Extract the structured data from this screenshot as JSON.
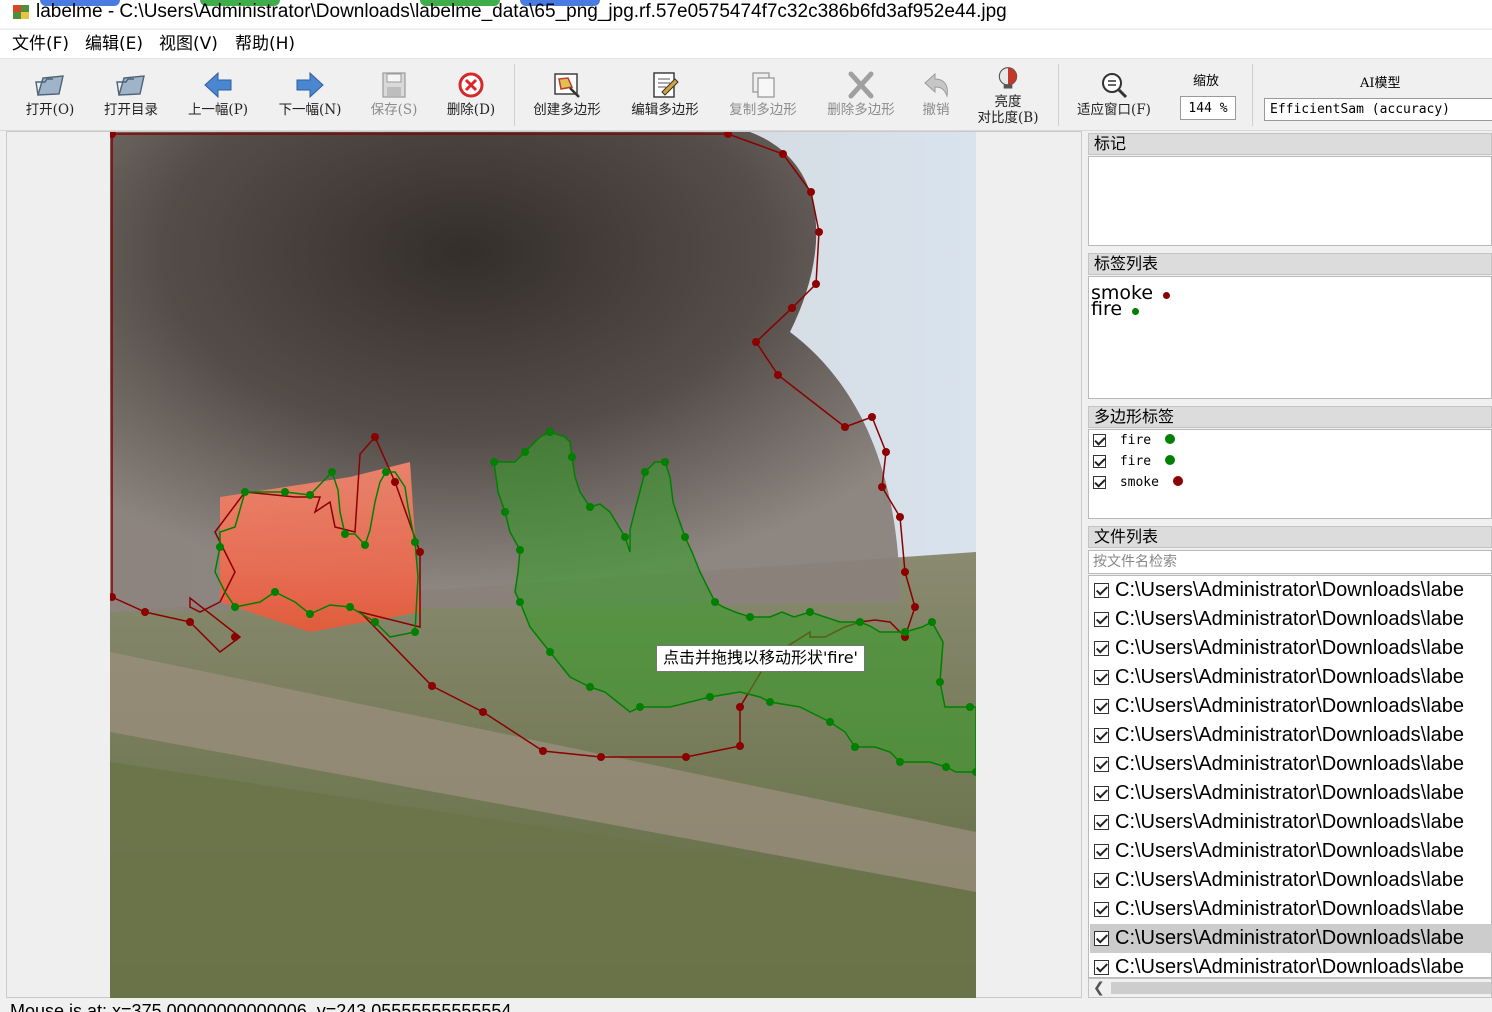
{
  "window": {
    "title": "labelme - C:\\Users\\Administrator\\Downloads\\labelme_data\\65_png_jpg.rf.57e0575474f7c32c386b6fd3af952e44.jpg"
  },
  "menu": [
    "文件(F)",
    "编辑(E)",
    "视图(V)",
    "帮助(H)"
  ],
  "toolbar": {
    "open": "打开(O)",
    "open_dir": "打开目录",
    "prev": "上一幅(P)",
    "next": "下一幅(N)",
    "save": "保存(S)",
    "delete": "删除(D)",
    "create_polygon": "创建多边形",
    "edit_polygon": "编辑多边形",
    "copy_polygon": "复制多边形",
    "delete_polygon": "删除多边形",
    "undo": "撤销",
    "brightness_1": "亮度",
    "brightness_2": "对比度(B)",
    "fit_window": "适应窗口(F)",
    "zoom_label": "缩放",
    "zoom_value": "144 %",
    "ai_label": "AI模型",
    "ai_model": "EfficientSam (accuracy)"
  },
  "canvas": {
    "tooltip": "点击并拖拽以移动形状'fire'"
  },
  "dock": {
    "flags_title": "标记",
    "label_list_title": "标签列表",
    "labels": [
      {
        "name": "smoke",
        "color": "#8b0000"
      },
      {
        "name": "fire",
        "color": "#008000"
      }
    ],
    "polygon_labels_title": "多边形标签",
    "polygons": [
      {
        "name": "fire",
        "color": "#008000",
        "checked": true
      },
      {
        "name": "fire",
        "color": "#008000",
        "checked": true
      },
      {
        "name": "smoke",
        "color": "#8b0000",
        "checked": true
      }
    ],
    "file_list_title": "文件列表",
    "file_search_placeholder": "按文件名检索",
    "files": [
      "C:\\Users\\Administrator\\Downloads\\labe",
      "C:\\Users\\Administrator\\Downloads\\labe",
      "C:\\Users\\Administrator\\Downloads\\labe",
      "C:\\Users\\Administrator\\Downloads\\labe",
      "C:\\Users\\Administrator\\Downloads\\labe",
      "C:\\Users\\Administrator\\Downloads\\labe",
      "C:\\Users\\Administrator\\Downloads\\labe",
      "C:\\Users\\Administrator\\Downloads\\labe",
      "C:\\Users\\Administrator\\Downloads\\labe",
      "C:\\Users\\Administrator\\Downloads\\labe",
      "C:\\Users\\Administrator\\Downloads\\labe",
      "C:\\Users\\Administrator\\Downloads\\labe",
      "C:\\Users\\Administrator\\Downloads\\labe",
      "C:\\Users\\Administrator\\Downloads\\labe"
    ]
  },
  "status": "Mouse is at: x=375.00000000000006, y=243.05555555555554"
}
